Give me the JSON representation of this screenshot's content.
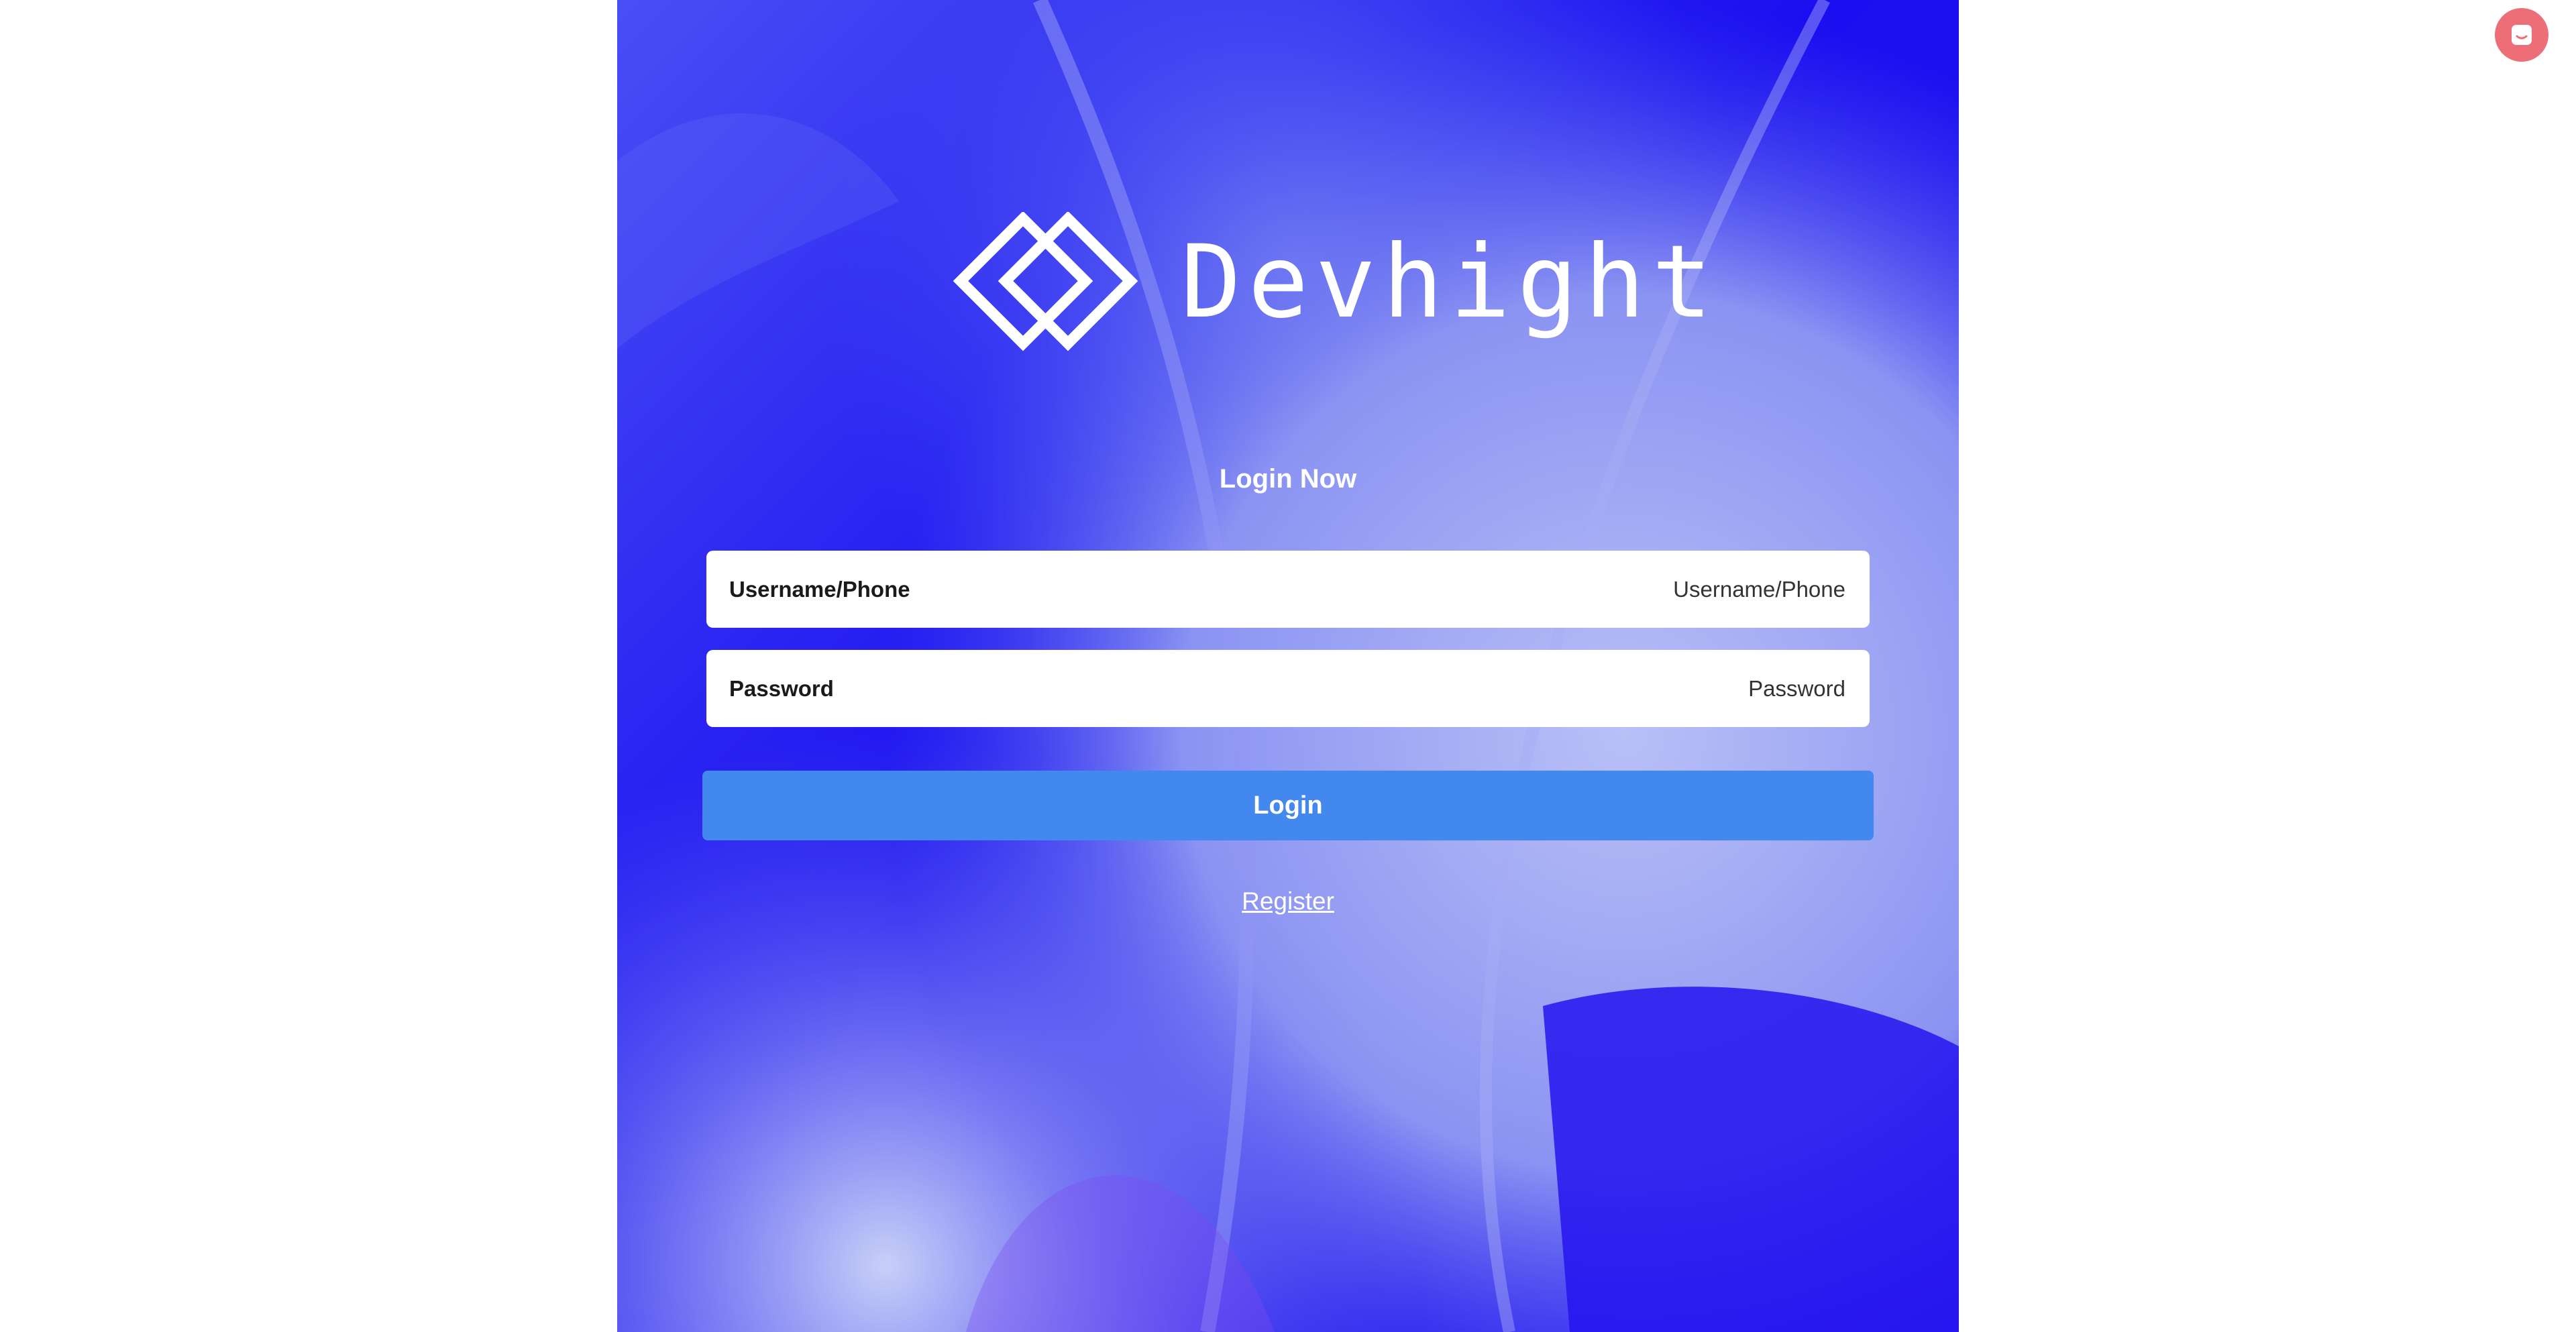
{
  "brand": {
    "name": "Devhight",
    "logo_icon": "double-diamond-logo-icon"
  },
  "login": {
    "title": "Login Now",
    "username_label": "Username/Phone",
    "username_placeholder": "Username/Phone",
    "password_label": "Password",
    "password_placeholder": "Password",
    "submit_label": "Login",
    "register_label": "Register"
  },
  "chat_widget": {
    "icon": "chat-icon"
  },
  "colors": {
    "background_panel": "#1a0ff0",
    "login_button": "#4388ee",
    "chat_widget": "#ee6e78",
    "page_background": "#ffffff"
  }
}
